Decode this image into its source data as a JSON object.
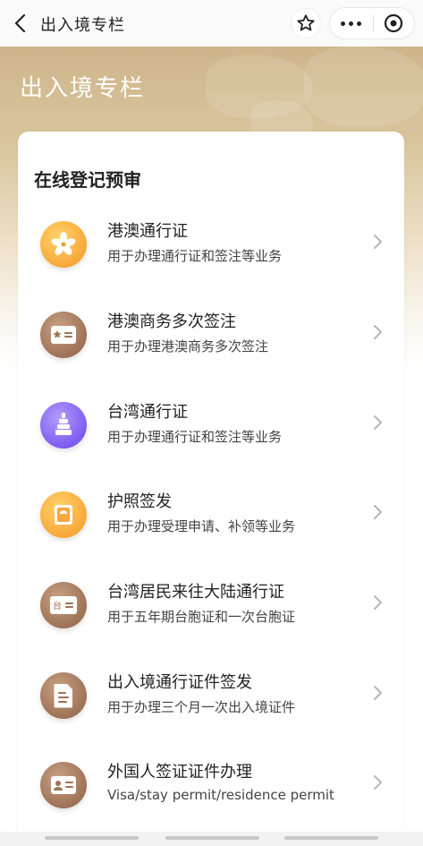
{
  "nav": {
    "title": "出入境专栏",
    "back_icon": "chevron-left-icon",
    "star_icon": "star-outline-icon",
    "more_icon": "more-dots-icon",
    "close_icon": "target-circle-icon"
  },
  "hero": {
    "title": "出入境专栏"
  },
  "section": {
    "title": "在线登记预审"
  },
  "colors": {
    "orange": "#f7a83a",
    "brown": "#9e7257",
    "purple": "#7d5cf0",
    "hero_gold": "#cdb58a"
  },
  "services": [
    {
      "title": "港澳通行证",
      "subtitle": "用于办理通行证和签注等业务",
      "icon": "bauhinia-flower-icon",
      "color": "orange"
    },
    {
      "title": "港澳商务多次签注",
      "subtitle": "用于办理港澳商务多次签注",
      "icon": "id-card-icon",
      "color": "brown"
    },
    {
      "title": "台湾通行证",
      "subtitle": "用于办理通行证和签注等业务",
      "icon": "landmark-tower-icon",
      "color": "purple"
    },
    {
      "title": "护照签发",
      "subtitle": "用于办理受理申请、补领等业务",
      "icon": "passport-icon",
      "color": "orange"
    },
    {
      "title": "台湾居民来往大陆通行证",
      "subtitle": "用于五年期台胞证和一次台胞证",
      "icon": "taiwan-card-icon",
      "color": "brown"
    },
    {
      "title": "出入境通行证件签发",
      "subtitle": "用于办理三个月一次出入境证件",
      "icon": "document-icon",
      "color": "brown"
    },
    {
      "title": "外国人签证证件办理",
      "subtitle": "Visa/stay permit/residence permit",
      "icon": "visa-card-icon",
      "color": "brown"
    }
  ]
}
